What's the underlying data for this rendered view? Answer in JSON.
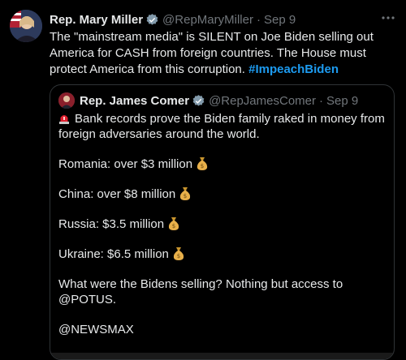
{
  "tweet": {
    "author_name": "Rep. Mary Miller",
    "handle": "@RepMaryMiller",
    "separator": "·",
    "time": "Sep 9",
    "text": "The \"mainstream media\" is SILENT on Joe Biden selling out America for CASH from foreign countries. The House must protect America from this corruption.",
    "hashtag": "#ImpeachBiden",
    "icons": {
      "verified": "verified-badge-icon",
      "more": "more-options-icon"
    }
  },
  "quote": {
    "author_name": "Rep. James Comer",
    "handle": "@RepJamesComer",
    "separator": "·",
    "time": "Sep 9",
    "intro": "Bank records prove the Biden family raked in money from foreign adversaries around the world.",
    "lines": [
      "Romania: over $3 million",
      "China: over $8 million",
      "Russia: $3.5 million",
      "Ukraine: $6.5 million"
    ],
    "question": "What were the Bidens selling? Nothing but access to @POTUS.",
    "footer": "@NEWSMAX",
    "icons": {
      "siren": "siren-emoji-icon",
      "money_bag": "money-bag-emoji-icon"
    }
  },
  "colors": {
    "background": "#000000",
    "text": "#e7e9ea",
    "muted": "#71767b",
    "accent": "#1d9bf0",
    "border": "#2f3336"
  }
}
